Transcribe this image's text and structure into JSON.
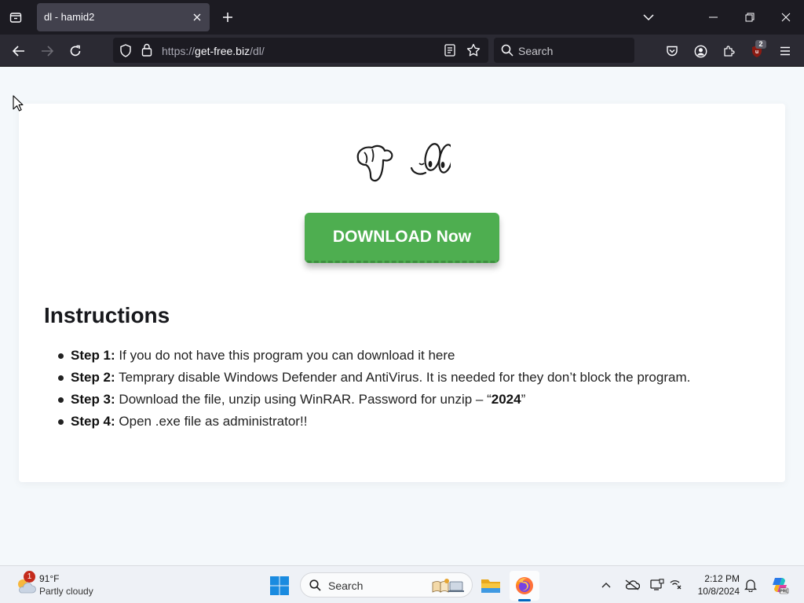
{
  "browser": {
    "tab_title": "dl - hamid2",
    "url_prefix": "https://",
    "url_host": "get-free.biz",
    "url_path": "/dl/",
    "search_placeholder": "Search",
    "extension_badge": "2"
  },
  "page": {
    "download_button": "DOWNLOAD Now",
    "instructions_title": "Instructions",
    "steps": [
      {
        "label": "Step 1:",
        "text": " If you do not have this program you can download it here"
      },
      {
        "label": "Step 2:",
        "text": " Temprary disable Windows Defender and AntiVirus. It is needed for they don’t block the program."
      },
      {
        "label": "Step 3:",
        "text": " Download the file, unzip using WinRAR. Password for unzip – “",
        "bold": "2024",
        "after": "”"
      },
      {
        "label": "Step 4:",
        "text": " Open .exe file as administrator!!"
      }
    ]
  },
  "taskbar": {
    "weather_temp": "91°F",
    "weather_desc": "Partly cloudy",
    "weather_badge": "1",
    "search_label": "Search",
    "time": "2:12 PM",
    "date": "10/8/2024"
  },
  "colors": {
    "download_green": "#4eae50",
    "browser_dark": "#1c1b22",
    "toolbar": "#2b2a33"
  }
}
